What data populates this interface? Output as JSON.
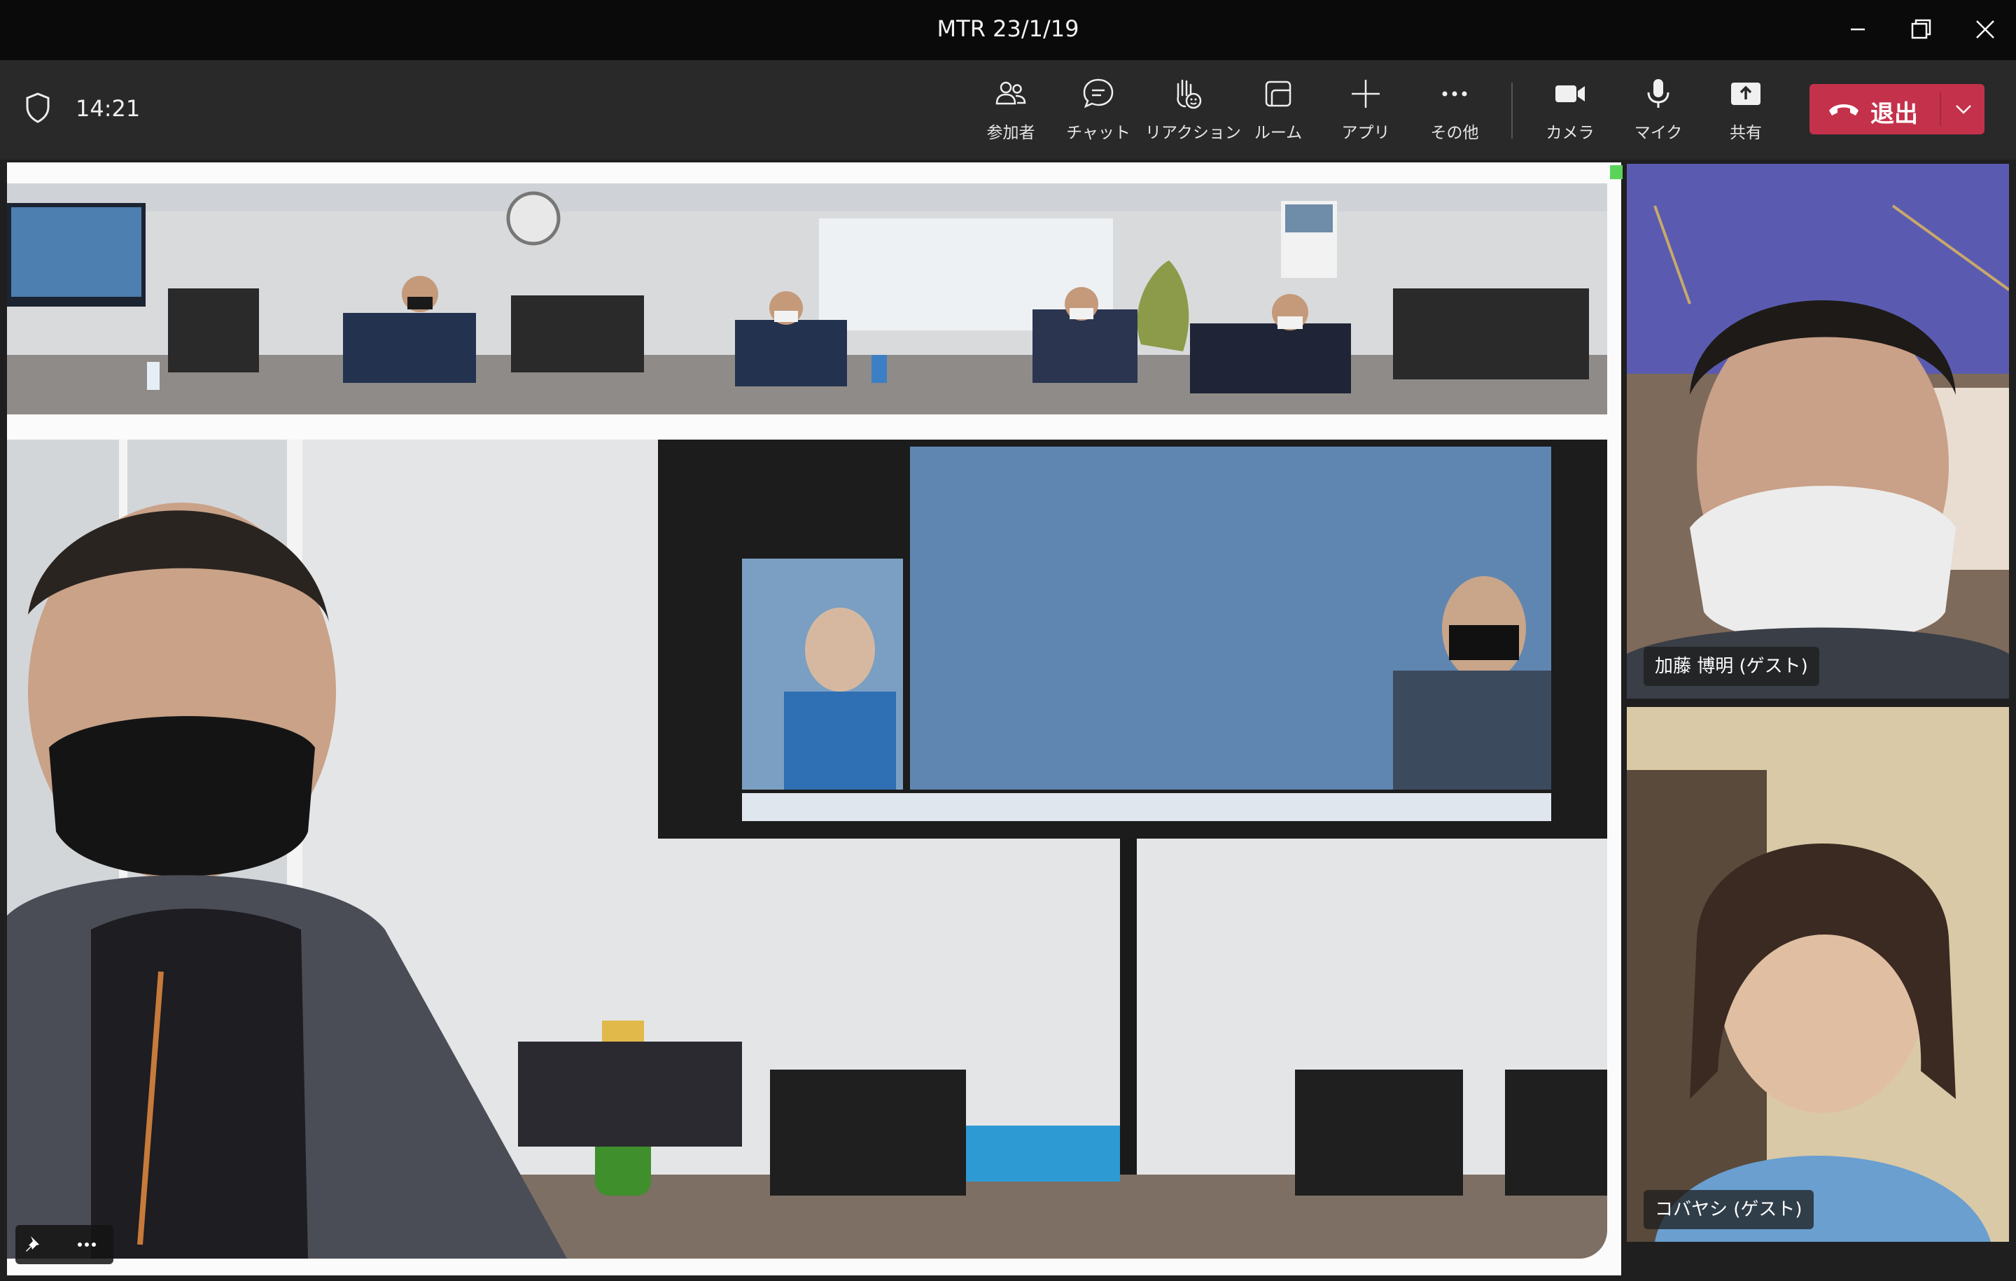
{
  "window": {
    "title": "MTR 23/1/19",
    "controls": {
      "minimize": "minimize-icon",
      "restore": "restore-icon",
      "close": "close-icon"
    }
  },
  "toolbar": {
    "time": "14:21",
    "buttons": [
      {
        "label": "参加者",
        "icon": "people-icon"
      },
      {
        "label": "チャット",
        "icon": "chat-icon"
      },
      {
        "label": "リアクション",
        "icon": "raise-hand-icon"
      },
      {
        "label": "ルーム",
        "icon": "rooms-icon"
      },
      {
        "label": "アプリ",
        "icon": "plus-icon"
      },
      {
        "label": "その他",
        "icon": "more-icon"
      },
      {
        "label": "カメラ",
        "icon": "camera-icon"
      },
      {
        "label": "マイク",
        "icon": "mic-icon"
      },
      {
        "label": "共有",
        "icon": "share-icon"
      }
    ],
    "leave_label": "退出",
    "leave_color": "#c4314b"
  },
  "participants": [
    {
      "name": "加藤 博明 (ゲスト)"
    },
    {
      "name": "コバヤシ (ゲスト)"
    }
  ],
  "stage": {
    "pin_icon": "pin-icon",
    "more_icon": "more-options-icon"
  }
}
